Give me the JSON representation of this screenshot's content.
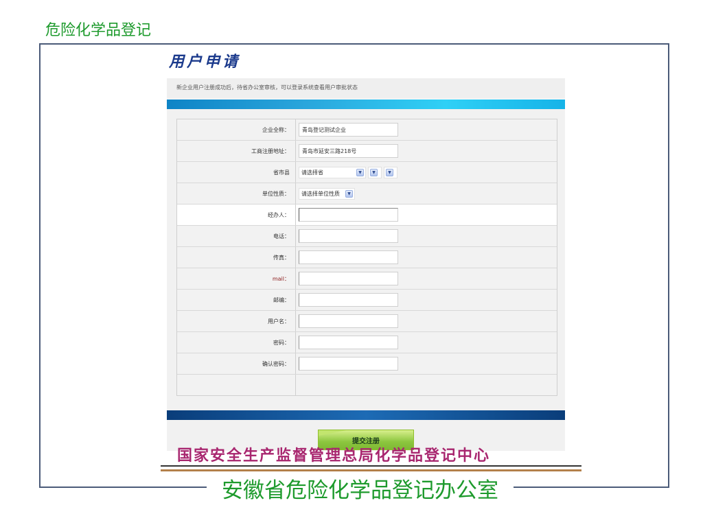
{
  "slide": {
    "title": "危险化学品登记"
  },
  "form": {
    "heading": "用户申请",
    "notice": "新企业用户注册成功后，待省办公室审核，可以登录系统查看用户审批状态",
    "rows": [
      {
        "label": "企业全称：",
        "type": "text",
        "value": "青岛登记测试企业"
      },
      {
        "label": "工商注册地址：",
        "type": "text",
        "value": "青岛市延安三路218号"
      },
      {
        "label": "省市县",
        "type": "region",
        "province_placeholder": "请选择省"
      },
      {
        "label": "单位性质：",
        "type": "select",
        "placeholder": "请选择单位性质"
      },
      {
        "label": "经办人：",
        "type": "text",
        "value": ""
      },
      {
        "label": "电话：",
        "type": "text",
        "value": ""
      },
      {
        "label": "传真：",
        "type": "text",
        "value": ""
      },
      {
        "label": "mail：",
        "type": "text",
        "value": ""
      },
      {
        "label": "邮编：",
        "type": "text",
        "value": ""
      },
      {
        "label": "用户名：",
        "type": "text",
        "value": ""
      },
      {
        "label": "密码：",
        "type": "text",
        "value": ""
      },
      {
        "label": "确认密码：",
        "type": "text",
        "value": ""
      }
    ],
    "submit_label": "提交注册"
  },
  "footer": {
    "organization": "国家安全生产监督管理总局化学品登记中心",
    "office": "安徽省危险化学品登记办公室"
  },
  "colors": {
    "title_green": "#1d9a2c",
    "heading_blue": "#1b3a8c",
    "org_magenta": "#a8266f",
    "submit_green": "#8cc63f"
  }
}
